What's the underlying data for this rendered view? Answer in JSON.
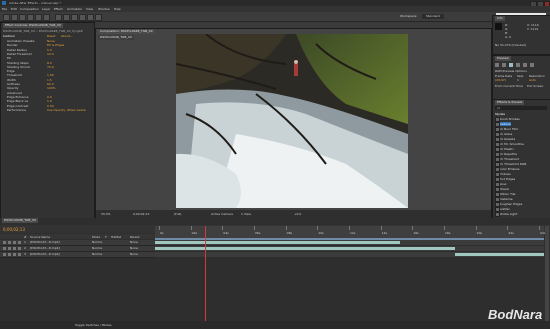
{
  "app": {
    "title": "Adobe After Effects - rollover.aep *",
    "workspace": "Workspace:",
    "workspace_value": "Standard",
    "search_placeholder": "Search Help"
  },
  "menu": [
    "File",
    "Edit",
    "Composition",
    "Layer",
    "Effect",
    "Animation",
    "View",
    "Window",
    "Help"
  ],
  "effect_controls": {
    "tab": "Effect Controls: DSCPro0948_TGB_XX",
    "comp": "DSCPro0948_TGB_XX • DSCPro0948_TGB_XX_Pyrgb6",
    "effect_name": "Cartoon",
    "reset_label": "Reset",
    "about_label": "About...",
    "rows": [
      {
        "label": "Animation Presets:",
        "value": "None"
      },
      {
        "label": "Render",
        "value": "Fill & Edges"
      },
      {
        "label": "Detail Radius",
        "value": "5.0"
      },
      {
        "label": "Detail Threshold",
        "value": "10.0"
      },
      {
        "label": "Fill",
        "value": ""
      },
      {
        "label": "Shading Steps",
        "value": "8.0"
      },
      {
        "label": "Shading Smoot",
        "value": "70.0"
      },
      {
        "label": "Edge",
        "value": ""
      },
      {
        "label": "Threshold",
        "value": "1.00"
      },
      {
        "label": "Width",
        "value": "1.5"
      },
      {
        "label": "Softness",
        "value": "60.0"
      },
      {
        "label": "Opacity",
        "value": "100%"
      },
      {
        "label": "Advanced",
        "value": ""
      },
      {
        "label": "Edge Enhance",
        "value": "0.0"
      },
      {
        "label": "Edge Black Le",
        "value": "1.0"
      },
      {
        "label": "Edge Contrast",
        "value": "0.50"
      },
      {
        "label": "Performance",
        "value": "Use Opacity, When Availa"
      }
    ]
  },
  "viewer": {
    "tab": "Composition: DSCPro0948_TGB_XX",
    "subtab": "DSCPro0948_TGB_XX",
    "zoom": "33.3%",
    "timecode": "0;00;02;13",
    "resolution": "(Full)",
    "camera": "Active Camera",
    "views": "1 View",
    "exposure": "+0.0"
  },
  "info_panel": {
    "tab": "Info",
    "r": "R:",
    "g": "G:",
    "b": "B:",
    "a": "A: 0",
    "x": "X: 1119",
    "y": "Y: 1119",
    "status": "No 31,470 (Clouded)"
  },
  "preview": {
    "tab": "Preview",
    "ram_options": "RAM Preview Options",
    "frame_rate": "Frame Rate",
    "frame_rate_value": "(29.97)",
    "skip": "Skip",
    "skip_value": "0",
    "resolution": "Resolution",
    "resolution_value": "Auto",
    "from_current": "From Current Time",
    "full_screen": "Full Screen"
  },
  "effects_presets": {
    "tab": "Effects & Presets",
    "search_value": "cc",
    "category": "Stylize",
    "items": [
      "Brush Strokes",
      "Cartoon",
      "CC Burn Film",
      "CC Glass",
      "CC Kaleida",
      "CC Mr. Smoothie",
      "CC Plastic",
      "CC RepeTile",
      "CC Threshold",
      "CC Threshold RGB",
      "Color Emboss",
      "Emboss",
      "Find Edges",
      "Glow",
      "Mosaic",
      "Motion Tile",
      "Posterize",
      "Roughen Edges",
      "Scatter",
      "Strobe Light"
    ]
  },
  "timeline": {
    "tab": "DSCPro0948_TGB_XX",
    "timecode": "0;00;02;13",
    "columns": [
      "#",
      "Source Name",
      "Mode",
      "T",
      "TrkMat",
      "Parent"
    ],
    "layers": [
      {
        "num": "1",
        "name": "[DSCProd3...8.mp4]",
        "mode": "Norma",
        "parent": "None"
      },
      {
        "num": "2",
        "name": "[DSCProd3...8.mp4]",
        "mode": "Norma",
        "parent": "None"
      },
      {
        "num": "3",
        "name": "[DSCProd3...8.mp4]",
        "mode": "Norma",
        "parent": "None"
      }
    ],
    "ruler": [
      "0s",
      "02s",
      "04s",
      "06s",
      "08s",
      "10s",
      "12s",
      "14s",
      "16s",
      "18s",
      "20s",
      "22s",
      "24s"
    ],
    "toggle_label": "Toggle Switches / Modes"
  },
  "watermark": "BodNara"
}
